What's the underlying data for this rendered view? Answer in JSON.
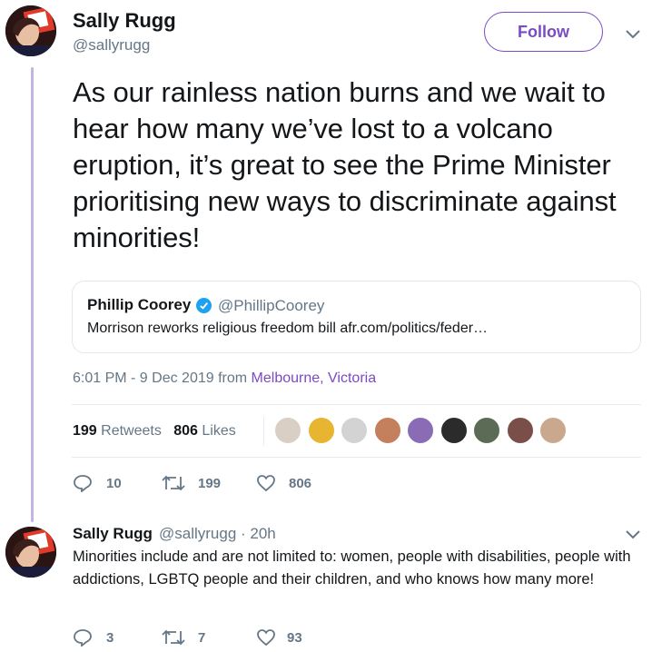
{
  "tweet": {
    "author_name": "Sally Rugg",
    "author_handle": "@sallyrugg",
    "follow_label": "Follow",
    "text": "As our rainless nation burns and we wait to hear how many we’ve lost to a volcano eruption, it’s great to see the Prime Minister prioritising new ways to discriminate against minorities!",
    "quote": {
      "name": "Phillip Coorey",
      "handle": "@PhillipCoorey",
      "text": "Morrison reworks religious freedom bill afr.com/politics/feder…"
    },
    "timestamp": "6:01 PM - 9 Dec 2019",
    "from_label": "from",
    "location": "Melbourne, Victoria",
    "retweets_count": "199",
    "retweets_label": "Retweets",
    "likes_count": "806",
    "likes_label": "Likes",
    "liker_avatar_colors": [
      "#d9cfc4",
      "#e8b530",
      "#d3d3d3",
      "#c47f5d",
      "#8a6bb5",
      "#2b2b2b",
      "#5c6b55",
      "#7a4f4a",
      "#c9a88e"
    ],
    "actions": {
      "replies": "10",
      "retweets": "199",
      "likes": "806"
    }
  },
  "reply": {
    "author_name": "Sally Rugg",
    "author_handle": "@sallyrugg · 20h",
    "text": "Minorities include and are not limited to: women, people with disabilities, people with addictions, LGBTQ people and their children, and who knows how many more!",
    "actions": {
      "replies": "3",
      "retweets": "7",
      "likes": "93"
    }
  },
  "colors": {
    "accent": "#794bc4",
    "thread_line": "#c5b4e3",
    "muted": "#657786"
  },
  "icons": [
    "chevron-down-icon",
    "verified-badge-icon",
    "reply-icon",
    "retweet-icon",
    "like-icon"
  ]
}
